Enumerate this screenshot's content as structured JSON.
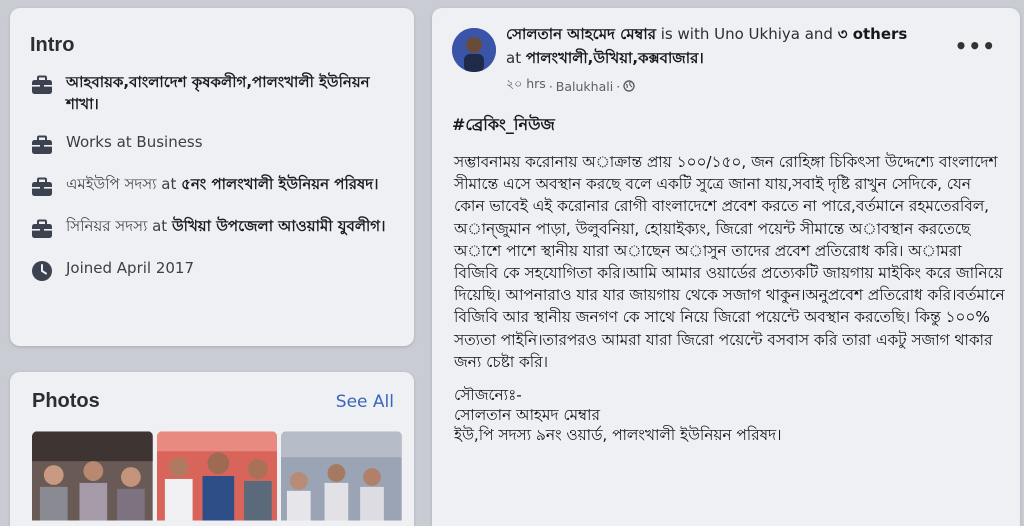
{
  "intro": {
    "title": "Intro",
    "items": [
      {
        "icon": "briefcase-icon",
        "prefix": "",
        "bold": "আহবায়ক,বাংলাদেশ কৃষকলীগ,পালংখালী ইউনিয়ন শাখা।"
      },
      {
        "icon": "briefcase-icon",
        "prefix": "Works at Business",
        "bold": ""
      },
      {
        "icon": "briefcase-icon",
        "prefix": "এমইউপি সদস্য at ",
        "bold": "৫নং পালংখালী ইউনিয়ন পরিষদ।"
      },
      {
        "icon": "briefcase-icon",
        "prefix": "সিনিয়র সদস্য at ",
        "bold": "উখিয়া উপজেলা আওয়ামী যুবলীগ।"
      },
      {
        "icon": "clock-icon",
        "prefix": "Joined April 2017",
        "bold": ""
      }
    ]
  },
  "photos": {
    "title": "Photos",
    "see_all": "See All"
  },
  "post": {
    "author": "সোলতান আহমেদ মেম্বার",
    "with_text": " is with Uno Ukhiya and ",
    "others": "৩ others",
    "at_text": " at ",
    "location": "পালংখালী,উখিয়া,কক্সবাজার।",
    "time": "২০ hrs",
    "separator1": " · ",
    "place": "Balukhali",
    "separator2": " · ",
    "more": "•••",
    "hashtag": "#ব্রেকিং_নিউজ",
    "body": "সম্ভাবনাময় করোনায় অাক্রান্ত প্রায় ১০০/১৫০, জন রোহিঙ্গা চিকিৎসা উদ্দেশ্যে বাংলাদেশ সীমান্তে এসে অবস্থান করছে বলে একটি সুত্রে জানা যায়,সবাই দৃষ্টি রাখুন সেদিকে, যেন কোন ভাবেই এই করোনার রোগী বাংলাদেশে প্রবেশ করতে না পারে,বর্তমানে রহমতেরবিল, অান্জুমান পাড়া, উলুবনিয়া, হোয়াইক্যং, জিরো পয়েন্ট সীমান্তে অাবস্থান করতেছে অাশে পাশে স্থানীয় যারা অাছেন অাসুন তাদের প্রবেশ প্রতিরোধ করি। অামরা বিজিবি কে সহযোগিতা করি।আমি আমার ওয়ার্ডের প্রত্যেকটি জায়গায় মাইকিং করে জানিয়ে দিয়েছি। আপনারাও যার যার জায়গায় থেকে সজাগ থাকুন।অনুপ্রবেশ প্রতিরোধ করি।বর্তমানে বিজিবি আর স্থানীয় জনগণ কে সাথে নিয়ে জিরো পয়েন্টে অবস্থান করতেছি। কিন্তু ১০০% সত্যতা পাইনি।তারপরও আমরা যারা জিরো পয়েন্টে বসবাস করি তারা একটু সজাগ থাকার জন্য চেষ্টা করি।",
    "credit_label": "সৌজন্যেঃ-",
    "credit_name": "সোলতান আহমদ মেম্বার",
    "credit_role": "ইউ,পি সদস্য ৯নং ওয়ার্ড, পালংখালী ইউনিয়ন পরিষদ।"
  }
}
